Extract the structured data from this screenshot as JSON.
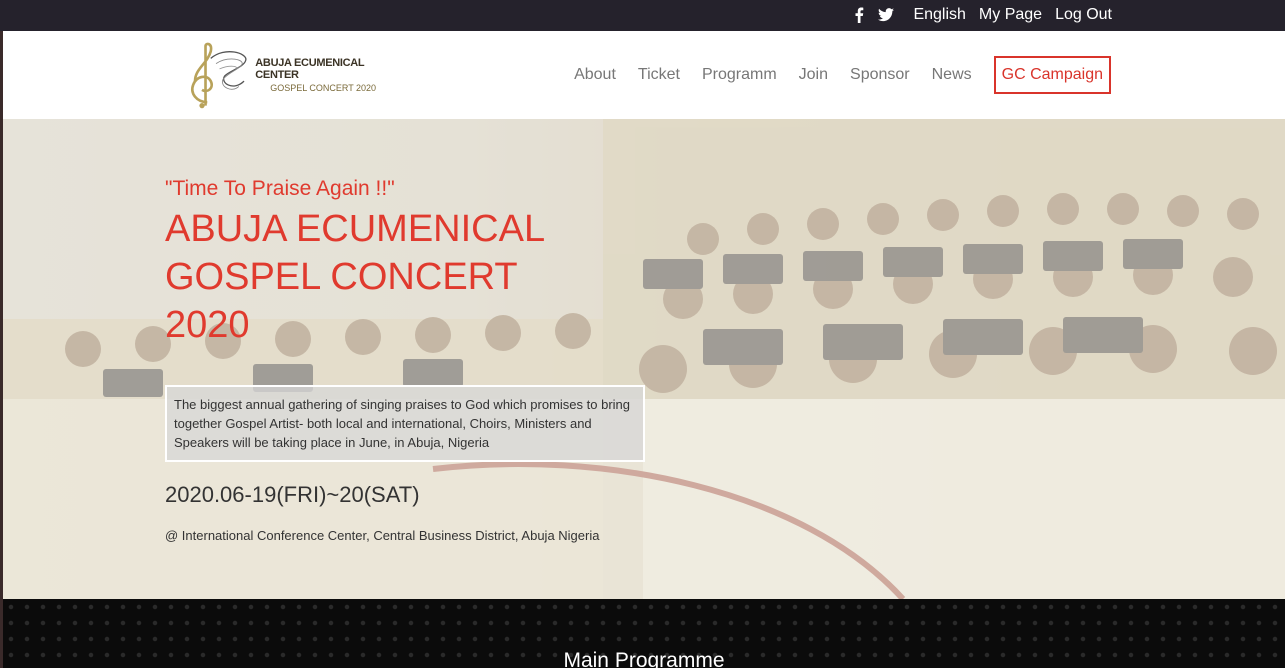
{
  "topbar": {
    "social": [
      "facebook-icon",
      "twitter-icon"
    ],
    "language": "English",
    "my_page": "My Page",
    "logout": "Log Out"
  },
  "logo": {
    "line1": "ABUJA ECUMENICAL CENTER",
    "line2": "GOSPEL CONCERT 2020"
  },
  "nav": {
    "items": [
      "About",
      "Ticket",
      "Programm",
      "Join",
      "Sponsor",
      "News"
    ],
    "cta": "GC Campaign"
  },
  "hero": {
    "tagline": "\"Time To Praise Again !!\"",
    "title": "ABUJA ECUMENICAL GOSPEL CONCERT 2020",
    "description": "The biggest annual gathering of singing praises to God which promises to bring together Gospel Artist- both local and international, Choirs, Ministers and Speakers will be taking place in June, in Abuja, Nigeria",
    "dates": "2020.06-19(FRI)~20(SAT)",
    "venue": "@ International Conference Center, Central Business District, Abuja Nigeria"
  },
  "section": {
    "heading": "Main Programme"
  },
  "colors": {
    "accent": "#e03a2e",
    "topbar": "#25222c",
    "nav_text": "#777777"
  }
}
